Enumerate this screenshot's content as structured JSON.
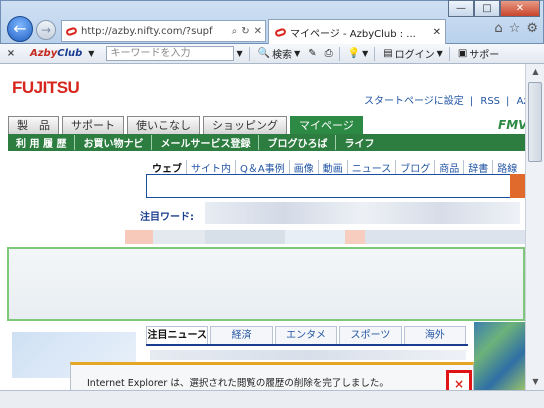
{
  "window": {
    "address": "http://azby.nifty.com/?supf",
    "tab_title": "マイページ - AzbyClub : ...",
    "controls": {
      "minimize": "—",
      "maximize": "□",
      "close": "✕"
    }
  },
  "toolbar": {
    "close_x": "×",
    "brand_a": "Azby",
    "brand_b": "Club",
    "keyword_placeholder": "キーワードを入力",
    "search": "検索",
    "login": "ログイン",
    "support": "サポー"
  },
  "site": {
    "logo": "FUJITSU",
    "top_links": [
      "スタートページに設定",
      "RSS",
      "Azby"
    ],
    "global_tabs": [
      "製　品",
      "サポート",
      "使いこなし",
      "ショッピング",
      "マイページ"
    ],
    "fmv": "FMV",
    "sub_nav": [
      "利 用 履 歴",
      "お買い物ナビ",
      "メールサービス登録",
      "ブログひろば",
      "ライフ"
    ],
    "search_tabs": [
      "ウェブ",
      "サイト内",
      "Q＆A事例",
      "画像",
      "動画",
      "ニュース",
      "ブログ",
      "商品",
      "辞書",
      "路線"
    ],
    "hot_words_label": "注目ワード:",
    "news_tabs": [
      "注目ニュース",
      "経済",
      "エンタメ",
      "スポーツ",
      "海外"
    ]
  },
  "notification": {
    "message": "Internet Explorer は、選択された閲覧の履歴の削除を完了しました。",
    "close": "×"
  }
}
